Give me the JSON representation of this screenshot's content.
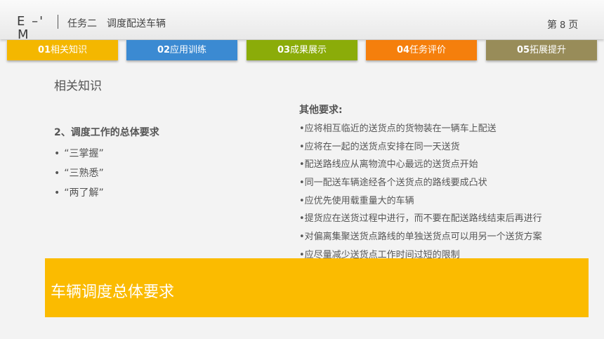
{
  "header": {
    "logo_line1": "E –'",
    "logo_line2": "M",
    "task_label": "任务二",
    "task_title": "调度配送车辆",
    "page_prefix": "第",
    "page_number": "8",
    "page_suffix": "页"
  },
  "tabs": [
    {
      "num": "01",
      "label": "相关知识"
    },
    {
      "num": "02",
      "label": "应用训练"
    },
    {
      "num": "03",
      "label": "成果展示"
    },
    {
      "num": "04",
      "label": "任务评价"
    },
    {
      "num": "05",
      "label": "拓展提升"
    }
  ],
  "section_title": "相关知识",
  "left": {
    "heading": "2、调度工作的总体要求",
    "items": [
      "“三掌握”",
      "“三熟悉”",
      "“两了解”"
    ]
  },
  "right": {
    "heading": "其他要求:",
    "items": [
      "•应将相互临近的送货点的货物装在一辆车上配送",
      "•应将在一起的送货点安排在同一天送货",
      "•配送路线应从离物流中心最远的送货点开始",
      "•同一配送车辆途经各个送货点的路线要成凸状",
      "•应优先使用载重量大的车辆",
      "•提货应在送货过程中进行，而不要在配送路线结束后再进行",
      "•对偏离集聚送货点路线的单独送货点可以用另一个送货方案",
      "•应尽量减少送货点工作时间过短的限制"
    ]
  },
  "banner": {
    "text": "车辆调度总体要求"
  }
}
